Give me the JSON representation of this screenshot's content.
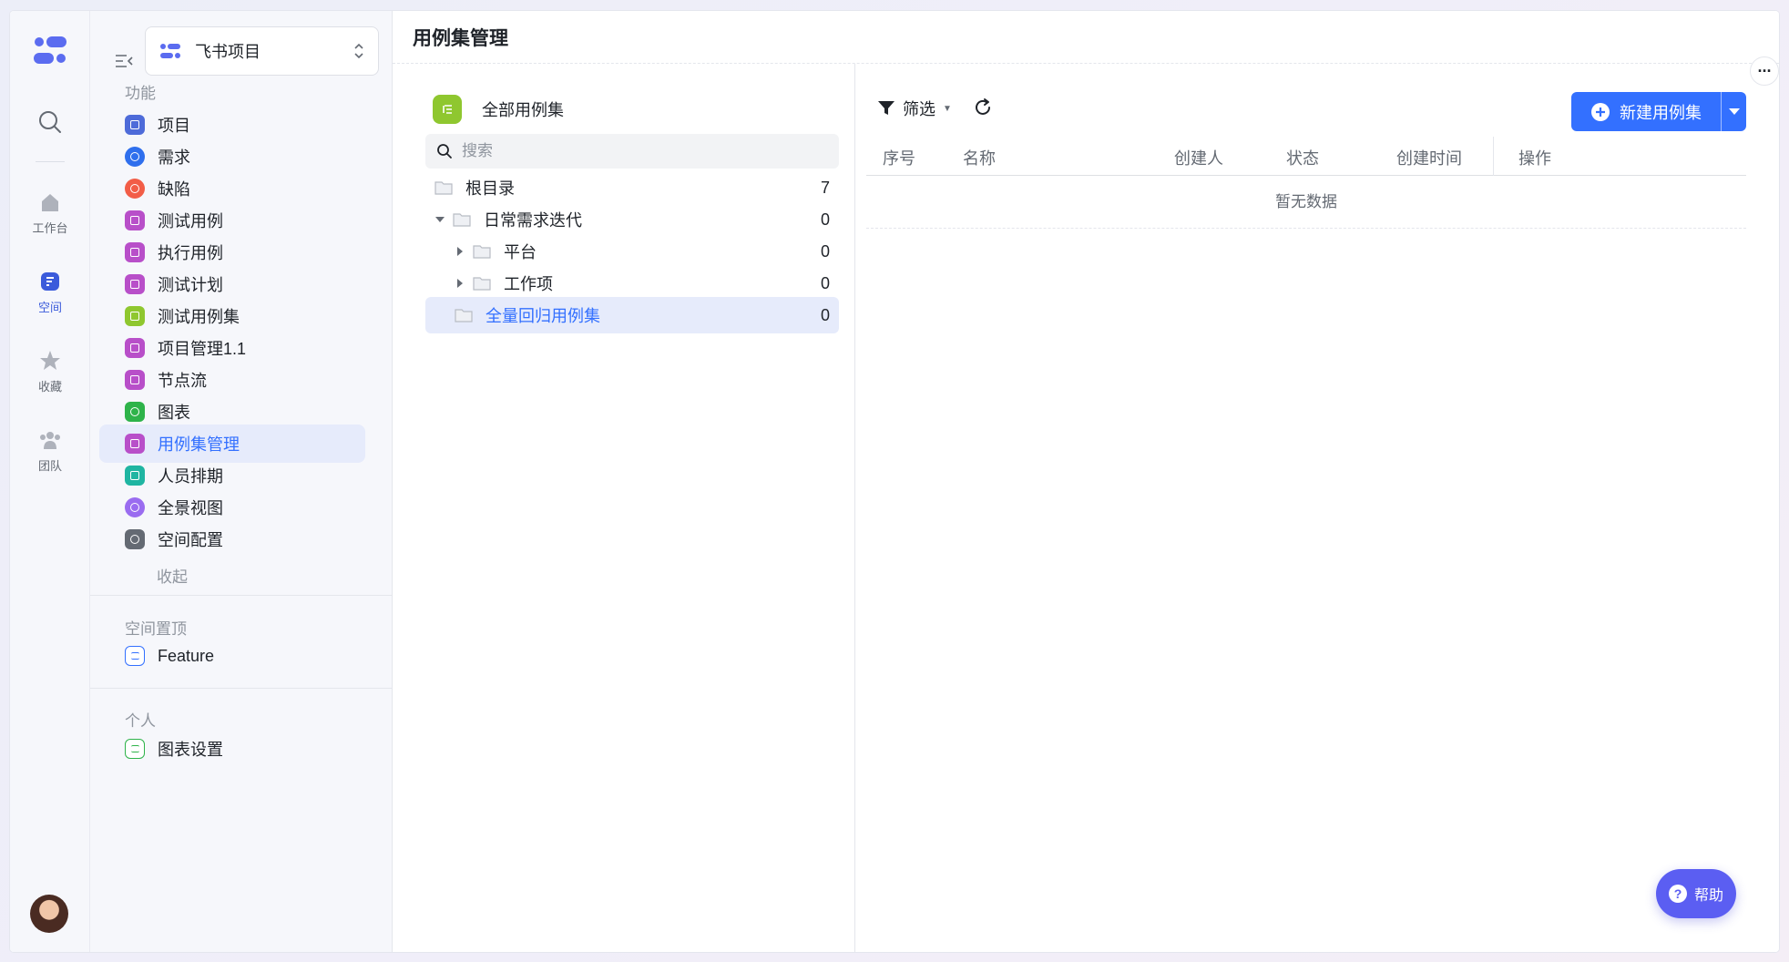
{
  "rail": {
    "items": [
      {
        "label": "工作台",
        "icon": "home-icon"
      },
      {
        "label": "空间",
        "icon": "space-icon"
      },
      {
        "label": "收藏",
        "icon": "star-icon"
      },
      {
        "label": "团队",
        "icon": "team-icon"
      }
    ]
  },
  "sidebar": {
    "project_name": "飞书项目",
    "features_title": "功能",
    "items": [
      {
        "label": "项目",
        "color": "#4e6bd9"
      },
      {
        "label": "需求",
        "color": "#2f6fed"
      },
      {
        "label": "缺陷",
        "color": "#f25d47"
      },
      {
        "label": "测试用例",
        "color": "#b84fc9"
      },
      {
        "label": "执行用例",
        "color": "#b84fc9"
      },
      {
        "label": "测试计划",
        "color": "#b84fc9"
      },
      {
        "label": "测试用例集",
        "color": "#8fc72f"
      },
      {
        "label": "项目管理1.1",
        "color": "#b84fc9"
      },
      {
        "label": "节点流",
        "color": "#b84fc9"
      },
      {
        "label": "图表",
        "color": "#2eb34a"
      },
      {
        "label": "用例集管理",
        "color": "#b84fc9"
      },
      {
        "label": "人员排期",
        "color": "#1fb5a2"
      },
      {
        "label": "全景视图",
        "color": "#9a6cf0"
      },
      {
        "label": "空间配置",
        "color": "#646a73"
      }
    ],
    "collapse_label": "收起",
    "pinned_title": "空间置顶",
    "pinned_items": [
      {
        "label": "Feature",
        "color": "#3370ff"
      }
    ],
    "personal_title": "个人",
    "personal_items": [
      {
        "label": "图表设置",
        "color": "#2eb34a"
      }
    ]
  },
  "main": {
    "title": "用例集管理",
    "tree": {
      "header": "全部用例集",
      "search_placeholder": "搜索",
      "rows": [
        {
          "label": "根目录",
          "count": "7"
        },
        {
          "label": "日常需求迭代",
          "count": "0"
        },
        {
          "label": "平台",
          "count": "0"
        },
        {
          "label": "工作项",
          "count": "0"
        },
        {
          "label": "全量回归用例集",
          "count": "0"
        }
      ]
    },
    "toolbar": {
      "filter_label": "筛选",
      "new_label": "新建用例集"
    },
    "table": {
      "columns": [
        "序号",
        "名称",
        "创建人",
        "状态",
        "创建时间",
        "操作"
      ],
      "empty_text": "暂无数据"
    }
  },
  "help": {
    "label": "帮助"
  },
  "colors": {
    "accent": "#3370ff",
    "help": "#5b5ef2",
    "active_bg": "#e6ebfb"
  }
}
